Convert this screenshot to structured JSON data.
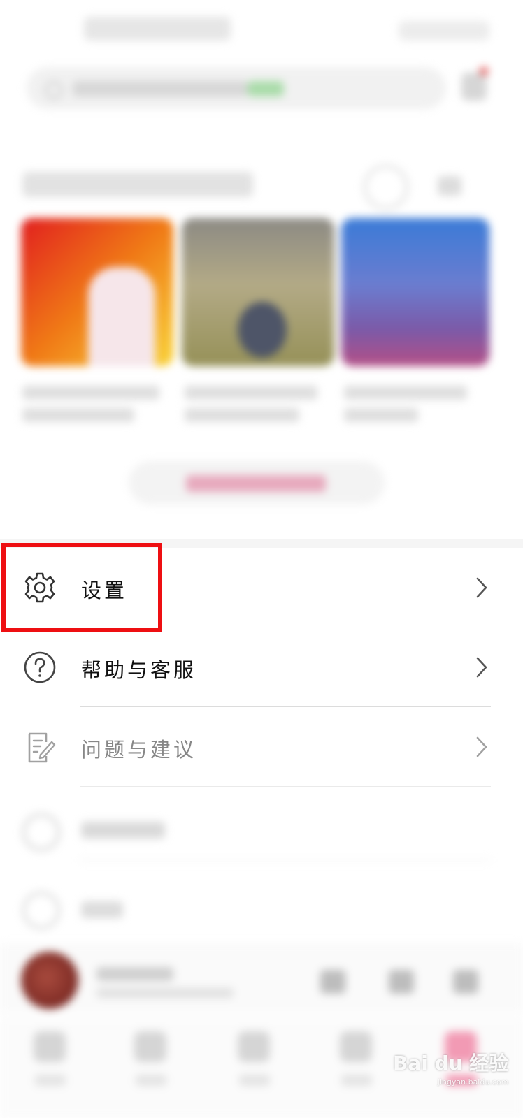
{
  "menu": {
    "settings_label": "设置",
    "help_label": "帮助与客服",
    "feedback_label": "问题与建议"
  },
  "icons": {
    "settings": "gear-icon",
    "help": "question-circle-icon",
    "feedback": "edit-document-icon",
    "chevron": "chevron-right-icon"
  },
  "colors": {
    "highlight": "#ee0f12"
  },
  "watermark": {
    "main": "Bai du 经验",
    "sub": "jingyan.baidu.com"
  }
}
